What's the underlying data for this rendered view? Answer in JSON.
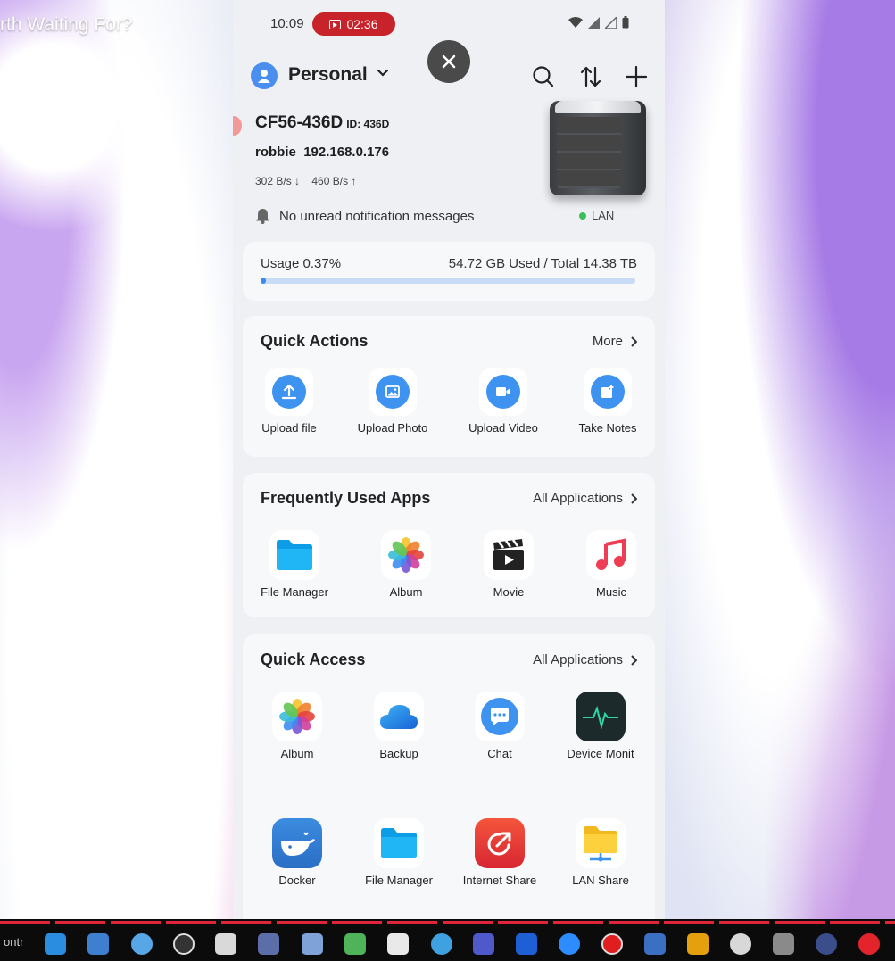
{
  "video": {
    "title": "rth Waiting For?"
  },
  "status_bar": {
    "time": "10:09",
    "recording_time": "02:36"
  },
  "header": {
    "account_name": "Personal"
  },
  "device": {
    "name": "CF56-436D",
    "id_label": "ID: 436D",
    "user": "robbie",
    "ip": "192.168.0.176",
    "download_speed": "302 B/s ↓",
    "upload_speed": "460 B/s ↑",
    "notification": "No unread notification messages",
    "connection": "LAN",
    "connection_color": "#39c05a"
  },
  "usage": {
    "label": "Usage 0.37%",
    "percent": 0.37,
    "total_text": "54.72 GB Used / Total 14.38 TB",
    "bar_color": "#3b8cf0"
  },
  "quick_actions": {
    "title": "Quick Actions",
    "more_label": "More",
    "items": [
      {
        "label": "Upload file",
        "icon": "upload-icon"
      },
      {
        "label": "Upload Photo",
        "icon": "photo-icon"
      },
      {
        "label": "Upload Video",
        "icon": "video-icon"
      },
      {
        "label": "Take Notes",
        "icon": "notes-icon"
      }
    ]
  },
  "frequently_used": {
    "title": "Frequently Used Apps",
    "link_label": "All Applications",
    "items": [
      {
        "label": "File Manager",
        "icon": "folder-icon"
      },
      {
        "label": "Album",
        "icon": "album-flower-icon"
      },
      {
        "label": "Movie",
        "icon": "clapperboard-icon"
      },
      {
        "label": "Music",
        "icon": "music-note-icon"
      }
    ]
  },
  "quick_access": {
    "title": "Quick Access",
    "link_label": "All Applications",
    "items": [
      {
        "label": "Album",
        "icon": "album-flower-icon"
      },
      {
        "label": "Backup",
        "icon": "cloud-icon"
      },
      {
        "label": "Chat",
        "icon": "chat-icon"
      },
      {
        "label": "Device Monit",
        "icon": "heartbeat-icon"
      },
      {
        "label": "Docker",
        "icon": "whale-icon"
      },
      {
        "label": "File Manager",
        "icon": "folder-icon"
      },
      {
        "label": "Internet Share",
        "icon": "share-icon"
      },
      {
        "label": "LAN Share",
        "icon": "lan-folder-icon"
      }
    ]
  },
  "taskbar": {
    "left_label": "ontr"
  },
  "colors": {
    "accent": "#3d93ef",
    "recording": "#c8222a",
    "taskbar_stripe": "#e0243a"
  }
}
